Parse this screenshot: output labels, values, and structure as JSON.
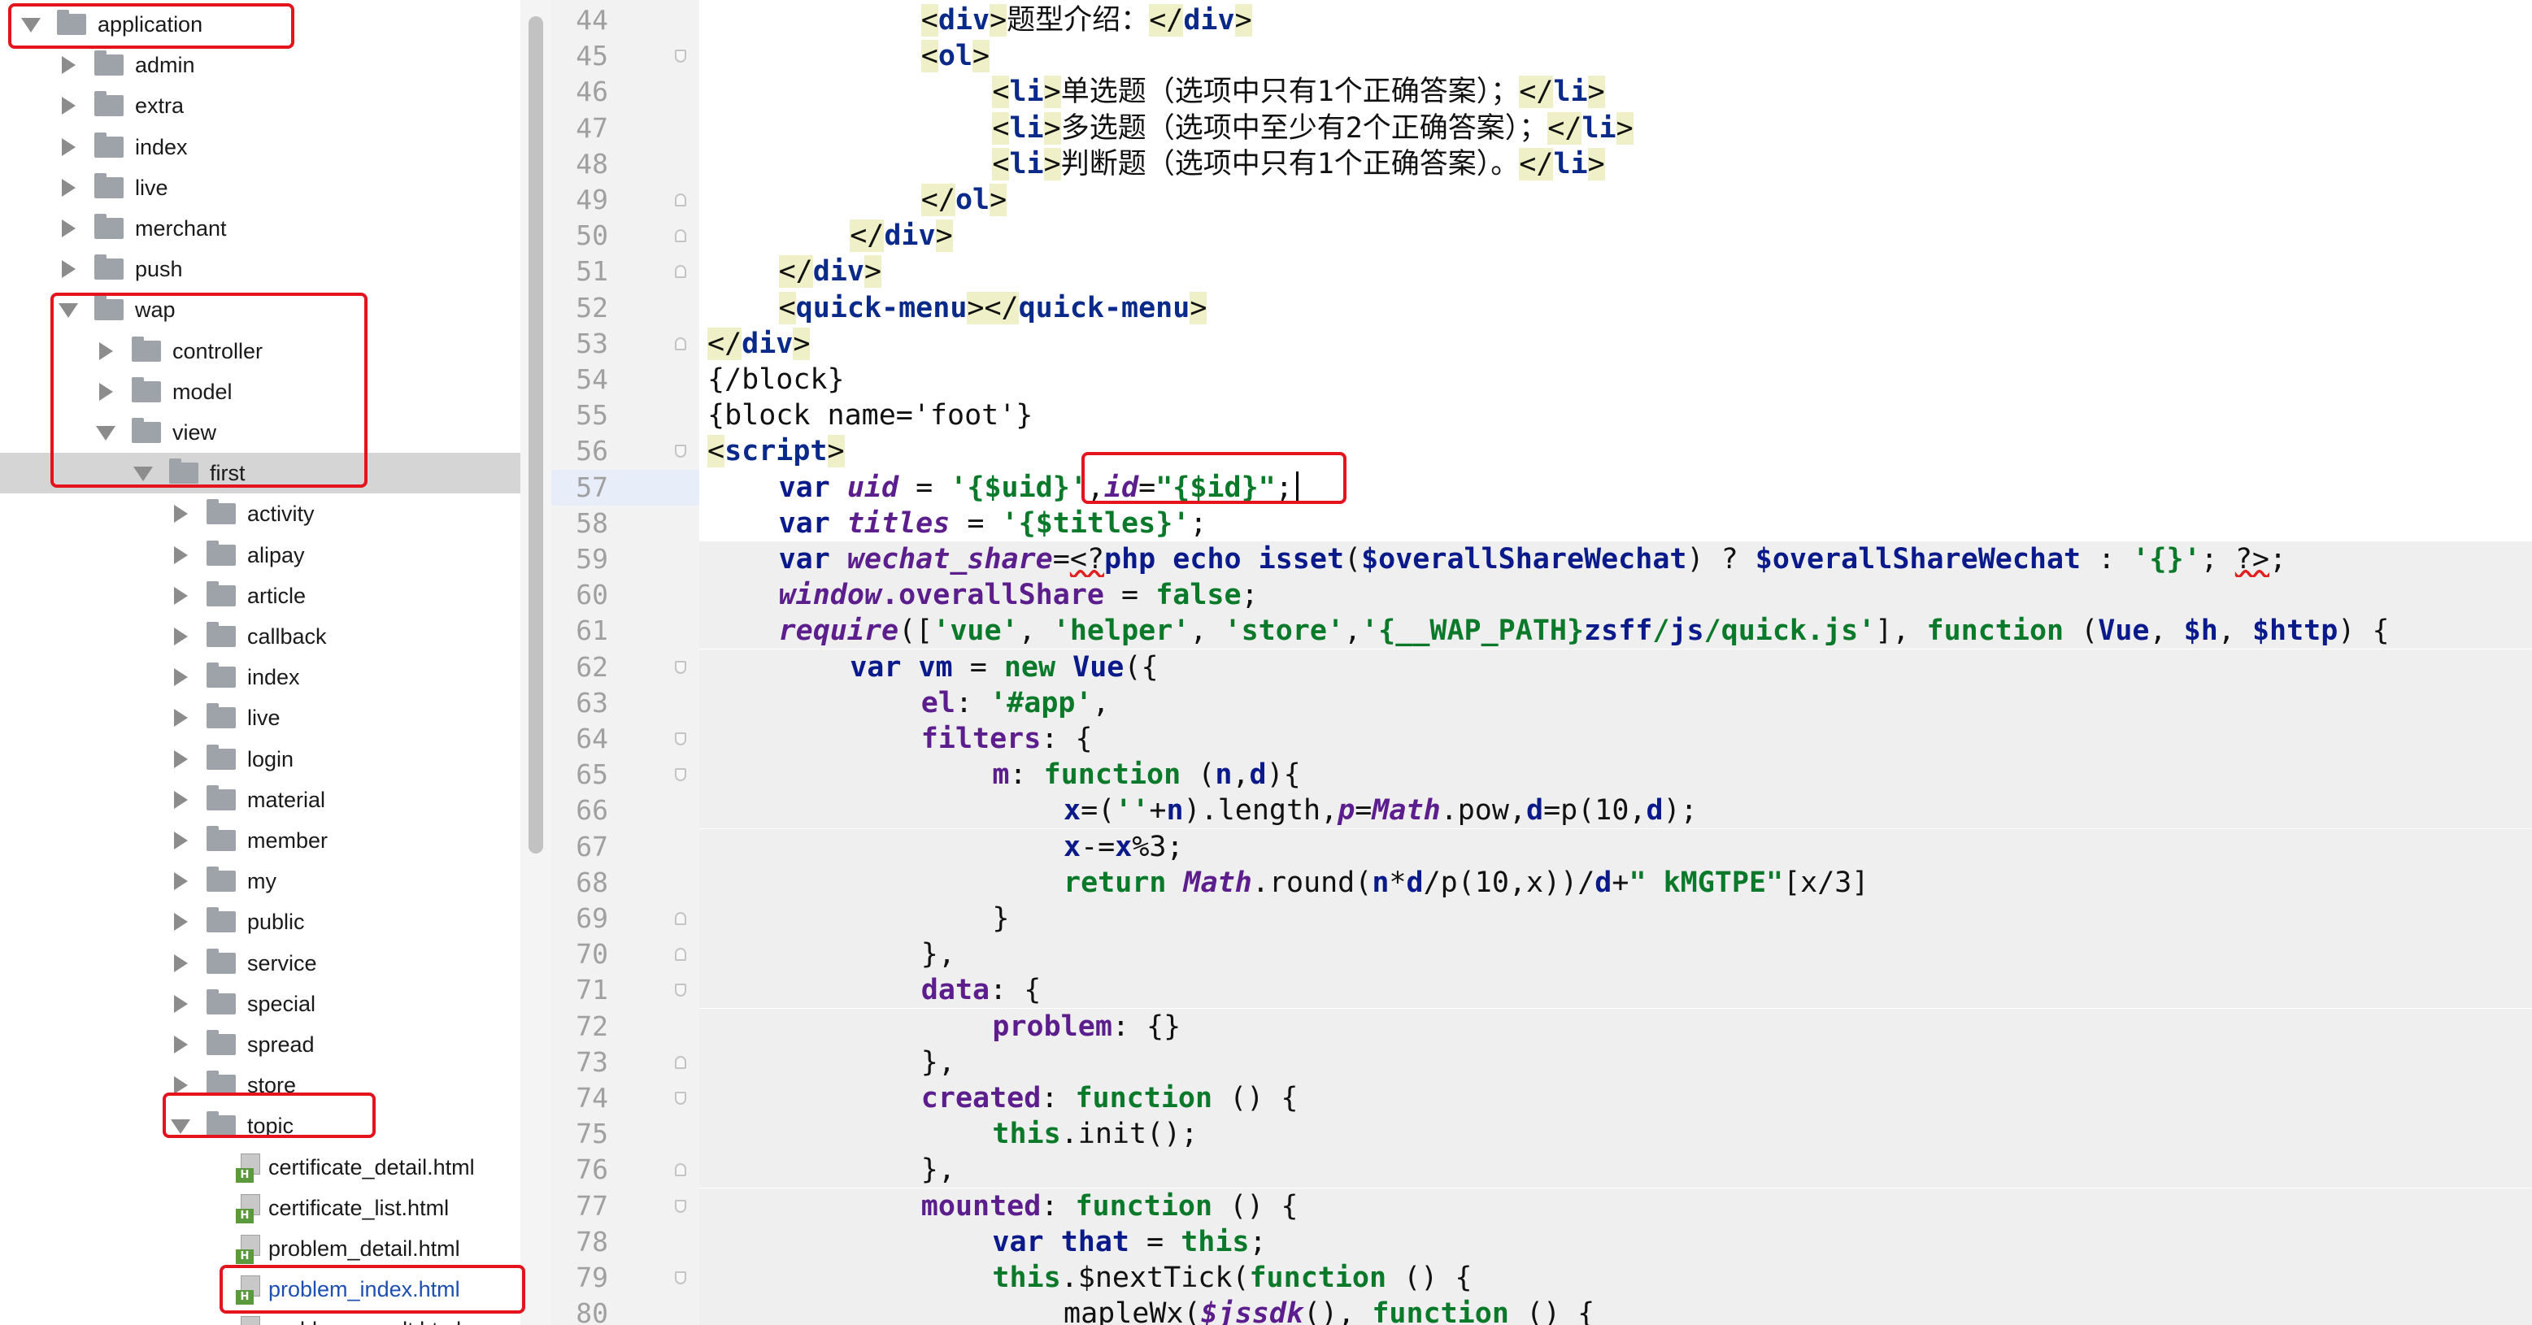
{
  "tree": {
    "items": [
      {
        "label": "application",
        "depth": 0,
        "kind": "folder",
        "state": "open"
      },
      {
        "label": "admin",
        "depth": 1,
        "kind": "folder",
        "state": "closed"
      },
      {
        "label": "extra",
        "depth": 1,
        "kind": "folder",
        "state": "closed"
      },
      {
        "label": "index",
        "depth": 1,
        "kind": "folder",
        "state": "closed"
      },
      {
        "label": "live",
        "depth": 1,
        "kind": "folder",
        "state": "closed"
      },
      {
        "label": "merchant",
        "depth": 1,
        "kind": "folder",
        "state": "closed"
      },
      {
        "label": "push",
        "depth": 1,
        "kind": "folder",
        "state": "closed"
      },
      {
        "label": "wap",
        "depth": 1,
        "kind": "folder",
        "state": "open"
      },
      {
        "label": "controller",
        "depth": 2,
        "kind": "folder",
        "state": "closed"
      },
      {
        "label": "model",
        "depth": 2,
        "kind": "folder",
        "state": "closed"
      },
      {
        "label": "view",
        "depth": 2,
        "kind": "folder",
        "state": "open"
      },
      {
        "label": "first",
        "depth": 3,
        "kind": "folder",
        "state": "open",
        "selected": true
      },
      {
        "label": "activity",
        "depth": 4,
        "kind": "folder",
        "state": "closed"
      },
      {
        "label": "alipay",
        "depth": 4,
        "kind": "folder",
        "state": "closed"
      },
      {
        "label": "article",
        "depth": 4,
        "kind": "folder",
        "state": "closed"
      },
      {
        "label": "callback",
        "depth": 4,
        "kind": "folder",
        "state": "closed"
      },
      {
        "label": "index",
        "depth": 4,
        "kind": "folder",
        "state": "closed"
      },
      {
        "label": "live",
        "depth": 4,
        "kind": "folder",
        "state": "closed"
      },
      {
        "label": "login",
        "depth": 4,
        "kind": "folder",
        "state": "closed"
      },
      {
        "label": "material",
        "depth": 4,
        "kind": "folder",
        "state": "closed"
      },
      {
        "label": "member",
        "depth": 4,
        "kind": "folder",
        "state": "closed"
      },
      {
        "label": "my",
        "depth": 4,
        "kind": "folder",
        "state": "closed"
      },
      {
        "label": "public",
        "depth": 4,
        "kind": "folder",
        "state": "closed"
      },
      {
        "label": "service",
        "depth": 4,
        "kind": "folder",
        "state": "closed"
      },
      {
        "label": "special",
        "depth": 4,
        "kind": "folder",
        "state": "closed"
      },
      {
        "label": "spread",
        "depth": 4,
        "kind": "folder",
        "state": "closed"
      },
      {
        "label": "store",
        "depth": 4,
        "kind": "folder",
        "state": "closed"
      },
      {
        "label": "topic",
        "depth": 4,
        "kind": "folder",
        "state": "open"
      },
      {
        "label": "certificate_detail.html",
        "depth": 5,
        "kind": "html"
      },
      {
        "label": "certificate_list.html",
        "depth": 5,
        "kind": "html"
      },
      {
        "label": "problem_detail.html",
        "depth": 5,
        "kind": "html"
      },
      {
        "label": "problem_index.html",
        "depth": 5,
        "kind": "html",
        "link": true
      },
      {
        "label": "problem_result.html",
        "depth": 5,
        "kind": "html"
      }
    ],
    "file_badge": "H"
  },
  "editor": {
    "current_line": 57,
    "lines": [
      {
        "n": 44,
        "indent": 12,
        "tokens": [
          [
            "tg",
            "<"
          ],
          [
            "tgb",
            "div"
          ],
          [
            "tg",
            ">"
          ],
          [
            "txt",
            "题型介绍："
          ],
          [
            "tg",
            "</"
          ],
          [
            "tgb",
            "div"
          ],
          [
            "tg",
            ">"
          ]
        ]
      },
      {
        "n": 45,
        "indent": 12,
        "fold": "down",
        "tokens": [
          [
            "tg",
            "<"
          ],
          [
            "tgb",
            "ol"
          ],
          [
            "tg",
            ">"
          ]
        ]
      },
      {
        "n": 46,
        "indent": 16,
        "tokens": [
          [
            "tg",
            "<"
          ],
          [
            "tgb",
            "li"
          ],
          [
            "tg",
            ">"
          ],
          [
            "txt",
            "单选题（选项中只有1个正确答案）；"
          ],
          [
            "tg",
            "</"
          ],
          [
            "tgb",
            "li"
          ],
          [
            "tg",
            ">"
          ]
        ]
      },
      {
        "n": 47,
        "indent": 16,
        "tokens": [
          [
            "tg",
            "<"
          ],
          [
            "tgb",
            "li"
          ],
          [
            "tg",
            ">"
          ],
          [
            "txt",
            "多选题（选项中至少有2个正确答案）；"
          ],
          [
            "tg",
            "</"
          ],
          [
            "tgb",
            "li"
          ],
          [
            "tg",
            ">"
          ]
        ]
      },
      {
        "n": 48,
        "indent": 16,
        "tokens": [
          [
            "tg",
            "<"
          ],
          [
            "tgb",
            "li"
          ],
          [
            "tg",
            ">"
          ],
          [
            "txt",
            "判断题（选项中只有1个正确答案）。"
          ],
          [
            "tg",
            "</"
          ],
          [
            "tgb",
            "li"
          ],
          [
            "tg",
            ">"
          ]
        ]
      },
      {
        "n": 49,
        "indent": 12,
        "fold": "up",
        "tokens": [
          [
            "tg",
            "</"
          ],
          [
            "tgb",
            "ol"
          ],
          [
            "tg",
            ">"
          ]
        ]
      },
      {
        "n": 50,
        "indent": 8,
        "fold": "up",
        "tokens": [
          [
            "tg",
            "</"
          ],
          [
            "tgb",
            "div"
          ],
          [
            "tg",
            ">"
          ]
        ]
      },
      {
        "n": 51,
        "indent": 4,
        "fold": "up",
        "tokens": [
          [
            "tg",
            "</"
          ],
          [
            "tgb",
            "div"
          ],
          [
            "tg",
            ">"
          ]
        ]
      },
      {
        "n": 52,
        "indent": 4,
        "tokens": [
          [
            "tg",
            "<"
          ],
          [
            "tgb",
            "quick-menu"
          ],
          [
            "tg",
            "></"
          ],
          [
            "tgb",
            "quick-menu"
          ],
          [
            "tg",
            ">"
          ]
        ]
      },
      {
        "n": 53,
        "indent": 0,
        "fold": "up",
        "tokens": [
          [
            "tg",
            "</"
          ],
          [
            "tgb",
            "div"
          ],
          [
            "tg",
            ">"
          ]
        ]
      },
      {
        "n": 54,
        "indent": 0,
        "tokens": [
          [
            "txt",
            "{/block}"
          ]
        ]
      },
      {
        "n": 55,
        "indent": 0,
        "tokens": [
          [
            "txt",
            "{block name='foot'}"
          ]
        ]
      },
      {
        "n": 56,
        "indent": 0,
        "fold": "down",
        "tokens": [
          [
            "tg",
            "<"
          ],
          [
            "tgb",
            "script"
          ],
          [
            "tg",
            ">"
          ]
        ]
      },
      {
        "n": 57,
        "indent": 4,
        "tokens": [
          [
            "kw",
            "var "
          ],
          [
            "vi",
            "uid"
          ],
          [
            "pu",
            " = "
          ],
          [
            "st",
            "'{$uid}'"
          ],
          [
            "pu",
            ","
          ],
          [
            "vi",
            "id"
          ],
          [
            "pu",
            "="
          ],
          [
            "st",
            "\"{$id}\""
          ],
          [
            "pu",
            ";"
          ]
        ]
      },
      {
        "n": 58,
        "indent": 4,
        "tokens": [
          [
            "kw",
            "var "
          ],
          [
            "vi",
            "titles"
          ],
          [
            "pu",
            " = "
          ],
          [
            "st",
            "'{$titles}'"
          ],
          [
            "pu",
            ";"
          ]
        ]
      },
      {
        "n": 59,
        "indent": 4,
        "shade": true,
        "tokens": [
          [
            "kw",
            "var "
          ],
          [
            "vi",
            "wechat_share"
          ],
          [
            "pu",
            "="
          ],
          [
            "wr",
            "<?"
          ],
          [
            "ph",
            "php "
          ],
          [
            "ph",
            "echo "
          ],
          [
            "ph",
            "isset"
          ],
          [
            "pu",
            "("
          ],
          [
            "ph",
            "$overallShareWechat"
          ],
          [
            "pu",
            ") ? "
          ],
          [
            "ph",
            "$overallShareWechat"
          ],
          [
            "pu",
            " : "
          ],
          [
            "st",
            "'{}'"
          ],
          [
            "pu",
            "; "
          ],
          [
            "wr",
            "?>"
          ],
          [
            "pu",
            ";"
          ]
        ]
      },
      {
        "n": 60,
        "indent": 4,
        "shade": true,
        "tokens": [
          [
            "vi",
            "window"
          ],
          [
            "pp",
            ".overallShare"
          ],
          [
            "pu",
            " = "
          ],
          [
            "gr",
            "false"
          ],
          [
            "pu",
            ";"
          ]
        ]
      },
      {
        "n": 61,
        "indent": 4,
        "shade": true,
        "tokens": [
          [
            "vi",
            "require"
          ],
          [
            "pu",
            "(["
          ],
          [
            "st",
            "'vue'"
          ],
          [
            "pu",
            ", "
          ],
          [
            "st",
            "'helper'"
          ],
          [
            "pu",
            ", "
          ],
          [
            "st",
            "'store'"
          ],
          [
            "pu",
            ","
          ],
          [
            "st",
            "'{__WAP_PATH}"
          ],
          [
            "ph",
            "zsff"
          ],
          [
            "st",
            "/"
          ],
          [
            "ph",
            "js"
          ],
          [
            "st",
            "/quick.js'"
          ],
          [
            "pu",
            "], "
          ],
          [
            "gr",
            "function "
          ],
          [
            "pu",
            "("
          ],
          [
            "ph",
            "Vue"
          ],
          [
            "pu",
            ", "
          ],
          [
            "ph",
            "$h"
          ],
          [
            "pu",
            ", "
          ],
          [
            "ph",
            "$http"
          ],
          [
            "pu",
            ") {"
          ]
        ]
      },
      {
        "n": 62,
        "indent": 8,
        "shade": true,
        "fold": "down",
        "tokens": [
          [
            "kw",
            "var "
          ],
          [
            "ph",
            "vm"
          ],
          [
            "pu",
            " = "
          ],
          [
            "gr",
            "new "
          ],
          [
            "ph",
            "Vue"
          ],
          [
            "pu",
            "({"
          ]
        ]
      },
      {
        "n": 63,
        "indent": 12,
        "shade": true,
        "tokens": [
          [
            "pp",
            "el"
          ],
          [
            "pu",
            ": "
          ],
          [
            "st",
            "'#app'"
          ],
          [
            "pu",
            ","
          ]
        ]
      },
      {
        "n": 64,
        "indent": 12,
        "shade": true,
        "fold": "down",
        "tokens": [
          [
            "pp",
            "filters"
          ],
          [
            "pu",
            ": {"
          ]
        ]
      },
      {
        "n": 65,
        "indent": 16,
        "shade": true,
        "fold": "down",
        "tokens": [
          [
            "pp",
            "m"
          ],
          [
            "pu",
            ": "
          ],
          [
            "gr",
            "function "
          ],
          [
            "pu",
            "("
          ],
          [
            "ph",
            "n"
          ],
          [
            "pu",
            ","
          ],
          [
            "ph",
            "d"
          ],
          [
            "pu",
            "){"
          ]
        ]
      },
      {
        "n": 66,
        "indent": 20,
        "shade": true,
        "tokens": [
          [
            "ph",
            "x"
          ],
          [
            "pu",
            "=("
          ],
          [
            "st",
            "''"
          ],
          [
            "pu",
            "+"
          ],
          [
            "ph",
            "n"
          ],
          [
            "pu",
            ").length,"
          ],
          [
            "vi",
            "p"
          ],
          [
            "pu",
            "="
          ],
          [
            "vi",
            "Math"
          ],
          [
            "pu",
            ".pow,"
          ],
          [
            "ph",
            "d"
          ],
          [
            "pu",
            "=p(10,"
          ],
          [
            "ph",
            "d"
          ],
          [
            "pu",
            ");"
          ]
        ]
      },
      {
        "n": 67,
        "indent": 20,
        "shade": true,
        "tokens": [
          [
            "ph",
            "x"
          ],
          [
            "pu",
            "-="
          ],
          [
            "ph",
            "x"
          ],
          [
            "pu",
            "%3;"
          ]
        ]
      },
      {
        "n": 68,
        "indent": 20,
        "shade": true,
        "tokens": [
          [
            "gr",
            "return "
          ],
          [
            "vi",
            "Math"
          ],
          [
            "pu",
            ".round("
          ],
          [
            "ph",
            "n"
          ],
          [
            "pu",
            "*"
          ],
          [
            "ph",
            "d"
          ],
          [
            "pu",
            "/p(10,x))/"
          ],
          [
            "ph",
            "d"
          ],
          [
            "pu",
            "+"
          ],
          [
            "st",
            "\" kMGTPE\""
          ],
          [
            "pu",
            "[x/3]"
          ]
        ]
      },
      {
        "n": 69,
        "indent": 16,
        "shade": true,
        "fold": "up",
        "tokens": [
          [
            "pu",
            "}"
          ]
        ]
      },
      {
        "n": 70,
        "indent": 12,
        "shade": true,
        "fold": "up",
        "tokens": [
          [
            "pu",
            "},"
          ]
        ]
      },
      {
        "n": 71,
        "indent": 12,
        "shade": true,
        "fold": "down",
        "tokens": [
          [
            "pp",
            "data"
          ],
          [
            "pu",
            ": {"
          ]
        ]
      },
      {
        "n": 72,
        "indent": 16,
        "shade": true,
        "tokens": [
          [
            "pp",
            "problem"
          ],
          [
            "pu",
            ": {}"
          ]
        ]
      },
      {
        "n": 73,
        "indent": 12,
        "shade": true,
        "fold": "up",
        "tokens": [
          [
            "pu",
            "},"
          ]
        ]
      },
      {
        "n": 74,
        "indent": 12,
        "shade": true,
        "fold": "down",
        "tokens": [
          [
            "pp",
            "created"
          ],
          [
            "pu",
            ": "
          ],
          [
            "gr",
            "function "
          ],
          [
            "pu",
            "() {"
          ]
        ]
      },
      {
        "n": 75,
        "indent": 16,
        "shade": true,
        "tokens": [
          [
            "gr",
            "this"
          ],
          [
            "pu",
            ".init();"
          ]
        ]
      },
      {
        "n": 76,
        "indent": 12,
        "shade": true,
        "fold": "up",
        "tokens": [
          [
            "pu",
            "},"
          ]
        ]
      },
      {
        "n": 77,
        "indent": 12,
        "shade": true,
        "fold": "down",
        "tokens": [
          [
            "pp",
            "mounted"
          ],
          [
            "pu",
            ": "
          ],
          [
            "gr",
            "function "
          ],
          [
            "pu",
            "() {"
          ]
        ]
      },
      {
        "n": 78,
        "indent": 16,
        "shade": true,
        "tokens": [
          [
            "kw",
            "var "
          ],
          [
            "ph",
            "that"
          ],
          [
            "pu",
            " = "
          ],
          [
            "gr",
            "this"
          ],
          [
            "pu",
            ";"
          ]
        ]
      },
      {
        "n": 79,
        "indent": 16,
        "shade": true,
        "fold": "down",
        "tokens": [
          [
            "gr",
            "this"
          ],
          [
            "pu",
            ".$nextTick("
          ],
          [
            "gr",
            "function "
          ],
          [
            "pu",
            "() {"
          ]
        ]
      },
      {
        "n": 80,
        "indent": 20,
        "shade": true,
        "tokens": [
          [
            "pu",
            "mapleWx("
          ],
          [
            "vi",
            "$jssdk"
          ],
          [
            "pu",
            "(), "
          ],
          [
            "gr",
            "function "
          ],
          [
            "pu",
            "() {"
          ]
        ]
      }
    ]
  },
  "watermark": "..."
}
